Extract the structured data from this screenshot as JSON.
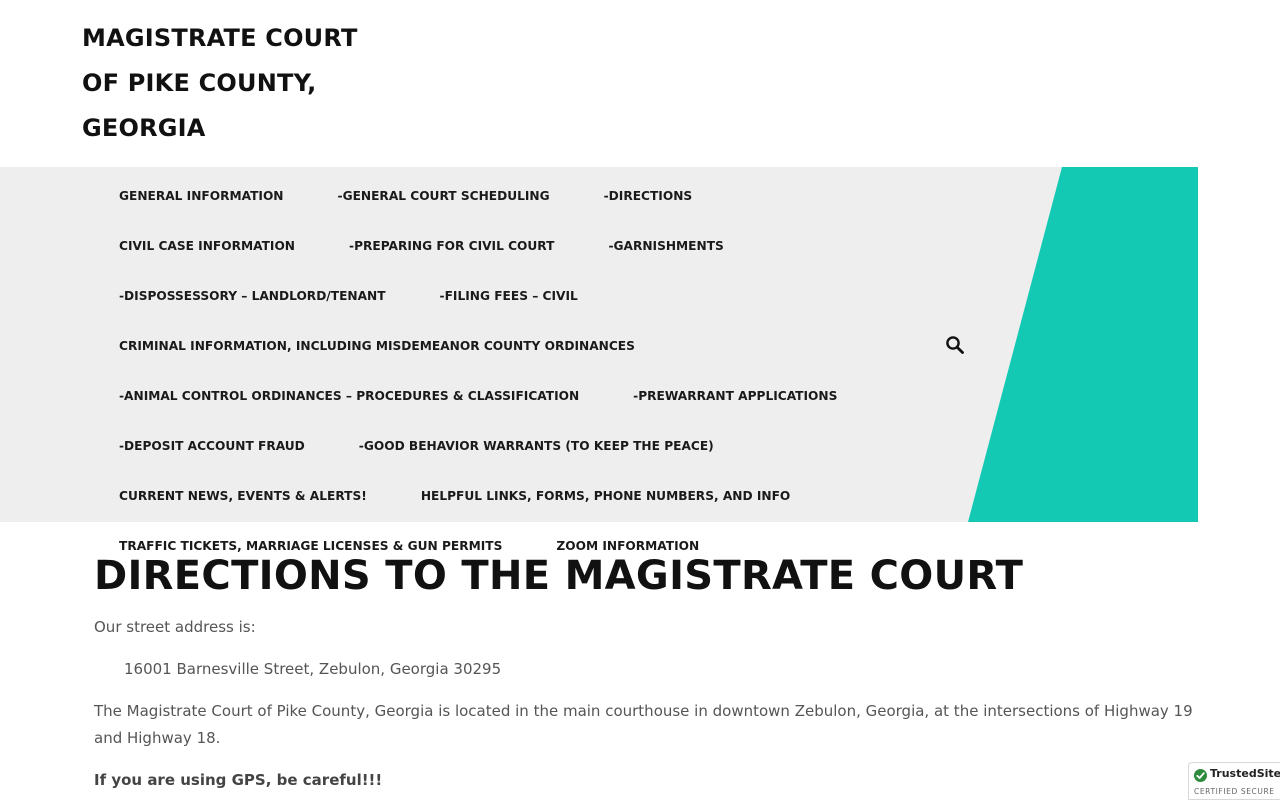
{
  "site": {
    "title_line1": "MAGISTRATE COURT",
    "title_line2": "OF PIKE COUNTY,",
    "title_line3": "GEORGIA"
  },
  "nav": {
    "items": [
      "GENERAL INFORMATION",
      "-GENERAL COURT SCHEDULING",
      "-DIRECTIONS",
      "CIVIL CASE INFORMATION",
      "-PREPARING FOR CIVIL COURT",
      "-GARNISHMENTS",
      "-DISPOSSESSORY – LANDLORD/TENANT",
      "-FILING FEES – CIVIL",
      "CRIMINAL INFORMATION, INCLUDING MISDEMEANOR COUNTY ORDINANCES",
      "-ANIMAL CONTROL ORDINANCES – PROCEDURES & CLASSIFICATION",
      "-PREWARRANT APPLICATIONS",
      "-DEPOSIT ACCOUNT FRAUD",
      "-GOOD BEHAVIOR WARRANTS (TO KEEP THE PEACE)",
      "CURRENT NEWS, EVENTS & ALERTS!",
      "HELPFUL LINKS, FORMS, PHONE NUMBERS, AND INFO",
      "TRAFFIC TICKETS, MARRIAGE LICENSES & GUN PERMITS",
      "ZOOM INFORMATION"
    ],
    "search_icon": "search-icon",
    "accent_color": "#14c9b4",
    "background_color": "#eeeeee"
  },
  "page": {
    "title": "DIRECTIONS TO THE MAGISTRATE COURT",
    "intro": "Our street address is:",
    "address": "16001 Barnesville Street, Zebulon, Georgia  30295",
    "location": "The Magistrate Court of Pike County, Georgia is located in the main courthouse in downtown Zebulon, Georgia, at the intersections of Highway 19 and Highway 18.",
    "gps_warning": "If you are using GPS, be careful!!!"
  },
  "badge": {
    "name": "TrustedSite",
    "mark": "®",
    "subtitle": "CERTIFIED SECURE",
    "icon": "check-icon"
  }
}
